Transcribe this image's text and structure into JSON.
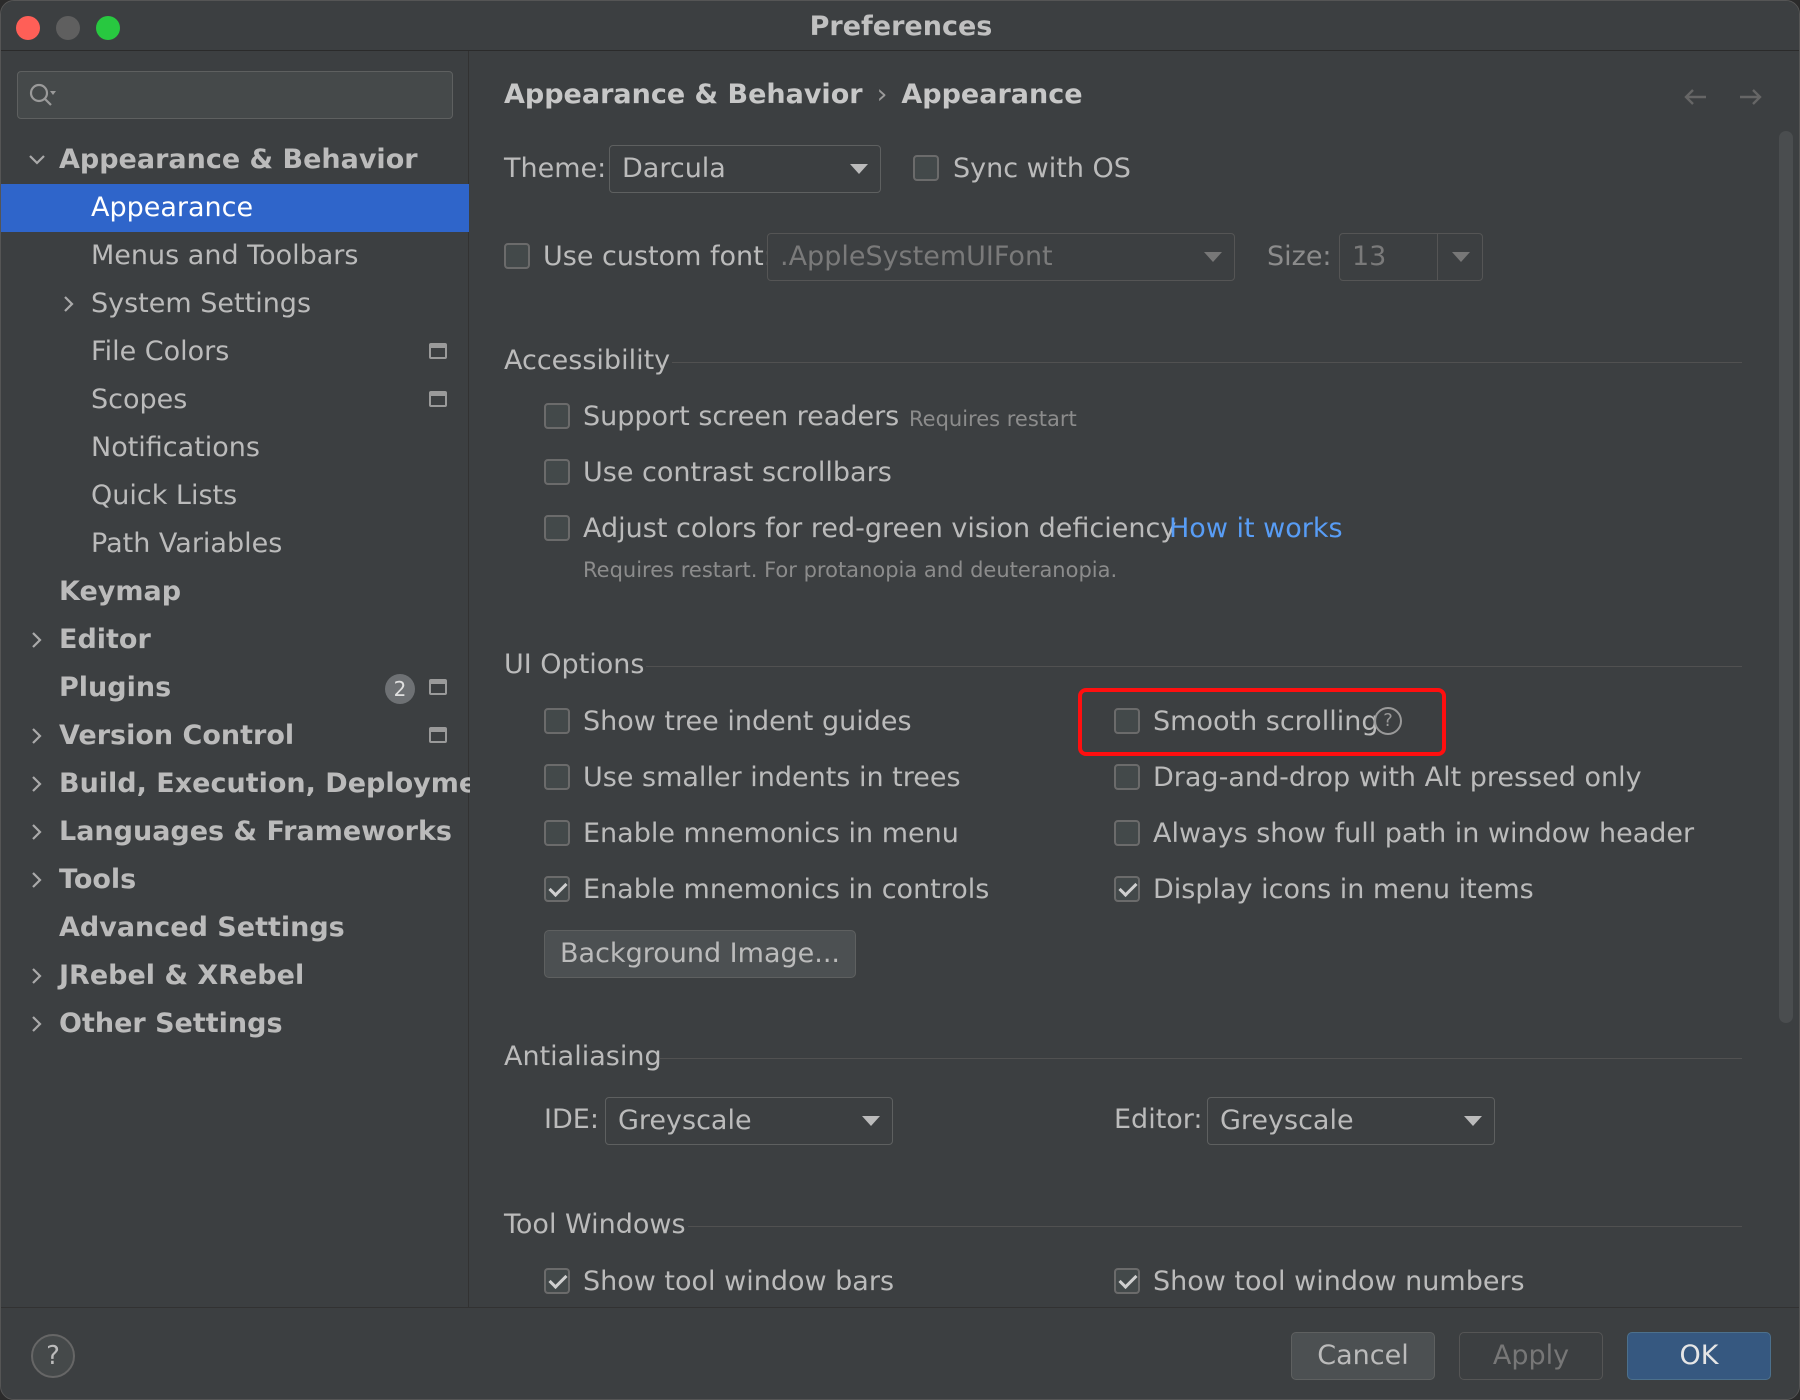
{
  "window": {
    "title": "Preferences"
  },
  "sidebar": {
    "search": {
      "placeholder": ""
    },
    "items": [
      {
        "label": "Appearance & Behavior",
        "expanded": true
      },
      {
        "label": "Appearance",
        "selected": true
      },
      {
        "label": "Menus and Toolbars"
      },
      {
        "label": "System Settings"
      },
      {
        "label": "File Colors"
      },
      {
        "label": "Scopes"
      },
      {
        "label": "Notifications"
      },
      {
        "label": "Quick Lists"
      },
      {
        "label": "Path Variables"
      },
      {
        "label": "Keymap"
      },
      {
        "label": "Editor"
      },
      {
        "label": "Plugins",
        "badge": "2"
      },
      {
        "label": "Version Control"
      },
      {
        "label": "Build, Execution, Deployment"
      },
      {
        "label": "Languages & Frameworks"
      },
      {
        "label": "Tools"
      },
      {
        "label": "Advanced Settings"
      },
      {
        "label": "JRebel & XRebel"
      },
      {
        "label": "Other Settings"
      }
    ]
  },
  "breadcrumb": {
    "parent": "Appearance & Behavior",
    "separator": "›",
    "current": "Appearance"
  },
  "theme": {
    "label": "Theme:",
    "value": "Darcula",
    "sync_label": "Sync with OS",
    "sync_checked": false
  },
  "font": {
    "custom_label": "Use custom font:",
    "custom_checked": false,
    "value": ".AppleSystemUIFont",
    "size_label": "Size:",
    "size_value": "13"
  },
  "accessibility": {
    "title": "Accessibility",
    "screen_readers": {
      "label": "Support screen readers",
      "hint": "Requires restart",
      "checked": false
    },
    "contrast_scrollbars": {
      "label": "Use contrast scrollbars",
      "checked": false
    },
    "color_deficiency": {
      "label": "Adjust colors for red-green vision deficiency",
      "link": "How it works",
      "hint": "Requires restart. For protanopia and deuteranopia.",
      "checked": false
    }
  },
  "ui_options": {
    "title": "UI Options",
    "left": [
      {
        "label": "Show tree indent guides",
        "checked": false
      },
      {
        "label": "Use smaller indents in trees",
        "checked": false
      },
      {
        "label": "Enable mnemonics in menu",
        "checked": false
      },
      {
        "label": "Enable mnemonics in controls",
        "checked": true
      }
    ],
    "right": [
      {
        "label": "Smooth scrolling",
        "checked": false,
        "help": "?"
      },
      {
        "label": "Drag-and-drop with Alt pressed only",
        "checked": false
      },
      {
        "label": "Always show full path in window header",
        "checked": false
      },
      {
        "label": "Display icons in menu items",
        "checked": true
      }
    ],
    "background_button": "Background Image..."
  },
  "antialiasing": {
    "title": "Antialiasing",
    "ide_label": "IDE:",
    "ide_value": "Greyscale",
    "editor_label": "Editor:",
    "editor_value": "Greyscale"
  },
  "tool_windows": {
    "title": "Tool Windows",
    "bars": {
      "label": "Show tool window bars",
      "checked": true
    },
    "numbers": {
      "label": "Show tool window numbers",
      "checked": true
    }
  },
  "footer": {
    "help": "?",
    "cancel": "Cancel",
    "apply": "Apply",
    "ok": "OK"
  },
  "colors": {
    "accent": "#2f65ca",
    "link": "#589df6",
    "highlight": "#ff0f0f",
    "background": "#3c3f41"
  }
}
